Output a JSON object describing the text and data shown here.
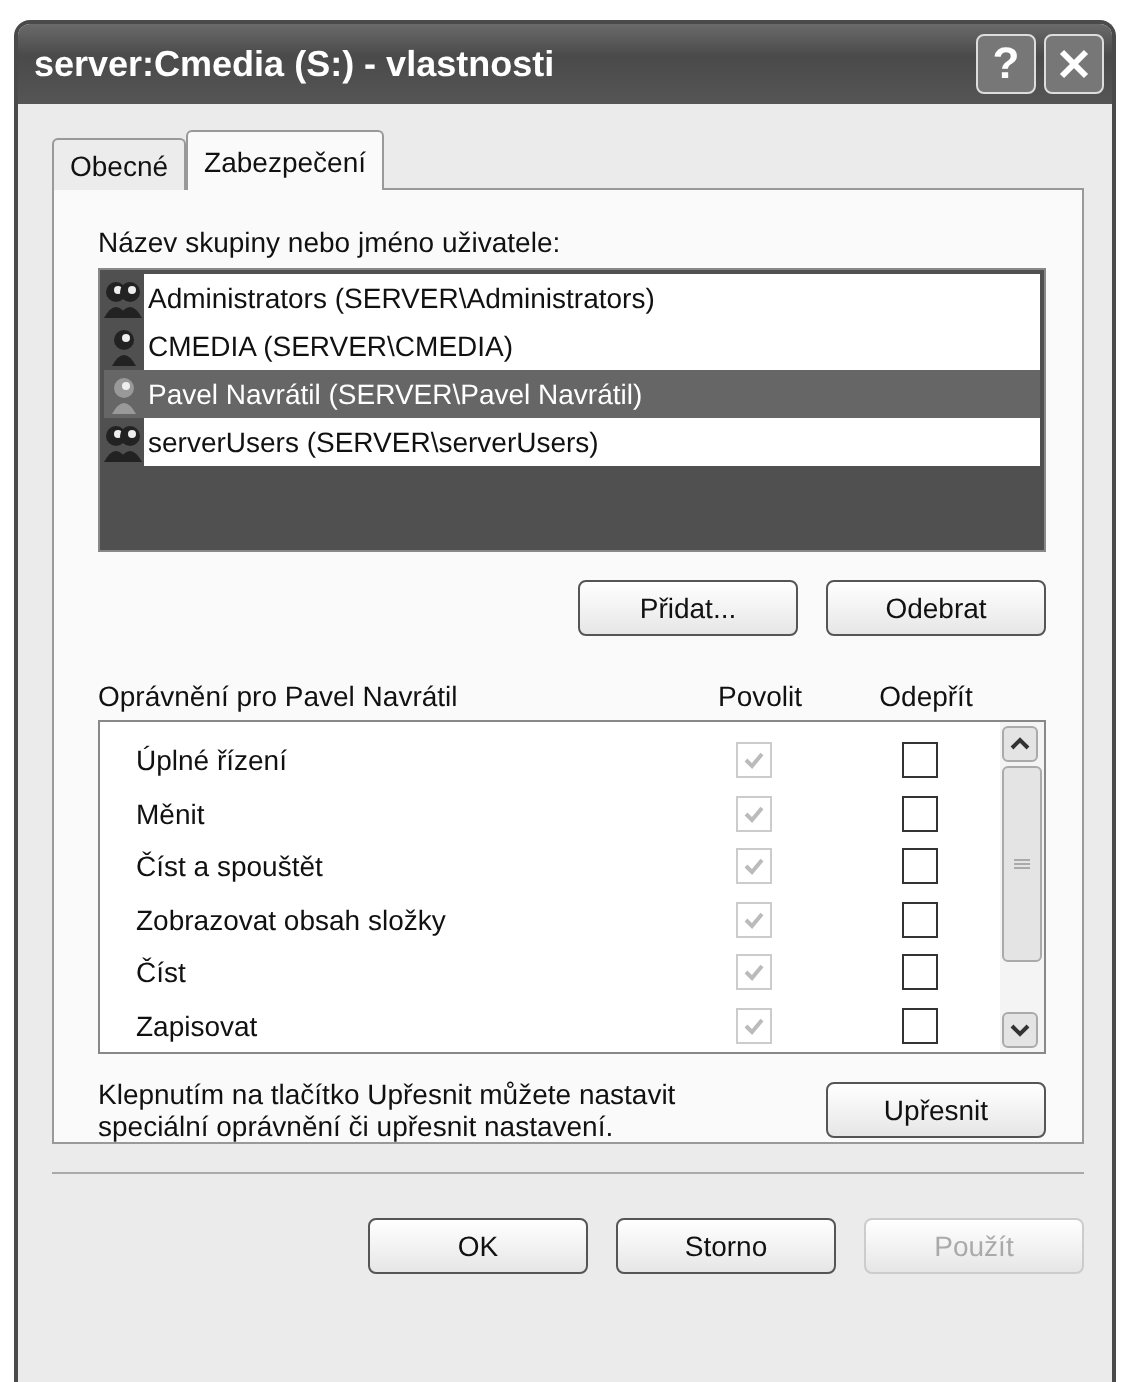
{
  "window": {
    "title": "server:Cmedia (S:) - vlastnosti",
    "help": "?"
  },
  "tabs": [
    {
      "label": "Obecné",
      "selected": false
    },
    {
      "label": "Zabezpečení",
      "selected": true
    }
  ],
  "users": {
    "label": "Název skupiny nebo jméno uživatele:",
    "items": [
      {
        "name": "Administrators (SERVER\\Administrators)",
        "kind": "group",
        "selected": false
      },
      {
        "name": "CMEDIA (SERVER\\CMEDIA)",
        "kind": "user",
        "selected": false
      },
      {
        "name": "Pavel Navrátil (SERVER\\Pavel Navrátil)",
        "kind": "user",
        "selected": true
      },
      {
        "name": "serverUsers (SERVER\\serverUsers)",
        "kind": "group",
        "selected": false
      }
    ],
    "buttons": [
      "Přidat...",
      "Odebrat"
    ]
  },
  "permissions": {
    "title": "Oprávnění pro Pavel Navrátil",
    "allow_header": "Povolit",
    "deny_header": "Odepřít",
    "rows": [
      {
        "label": "Úplné řízení",
        "allow_checked": true,
        "allow_disabled": true,
        "deny_checked": false
      },
      {
        "label": "Měnit",
        "allow_checked": true,
        "allow_disabled": true,
        "deny_checked": false
      },
      {
        "label": "Číst a spouštět",
        "allow_checked": true,
        "allow_disabled": true,
        "deny_checked": false
      },
      {
        "label": "Zobrazovat obsah složky",
        "allow_checked": true,
        "allow_disabled": true,
        "deny_checked": false
      },
      {
        "label": "Číst",
        "allow_checked": true,
        "allow_disabled": true,
        "deny_checked": false
      },
      {
        "label": "Zapisovat",
        "allow_checked": true,
        "allow_disabled": true,
        "deny_checked": false
      }
    ]
  },
  "advanced": {
    "text": "Klepnutím na tlačítko Upřesnit můžete nastavit speciální oprávnění či upřesnit nastavení.",
    "button": "Upřesnit"
  },
  "footer_buttons": [
    {
      "label": "OK",
      "disabled": false
    },
    {
      "label": "Storno",
      "disabled": false
    },
    {
      "label": "Použít",
      "disabled": true
    }
  ]
}
